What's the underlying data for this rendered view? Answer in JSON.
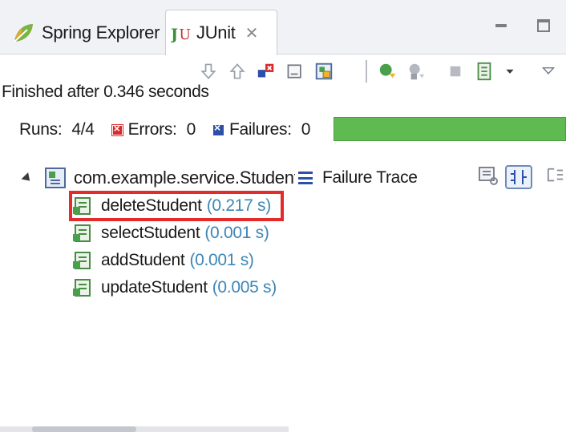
{
  "tabs": [
    {
      "label": "Spring Explorer",
      "icon": "leaf-icon",
      "active": false
    },
    {
      "label": "JUnit",
      "icon": "junit-icon",
      "active": true,
      "close": "✕"
    }
  ],
  "status": "Finished after 0.346 seconds",
  "counters": {
    "runs_label": "Runs:",
    "runs_value": "4/4",
    "errors_label": "Errors:",
    "errors_value": "0",
    "failures_label": "Failures:",
    "failures_value": "0"
  },
  "progress": {
    "fraction": 1.0,
    "color": "#5fba51"
  },
  "tree": {
    "root": "com.example.service.StudentServiceTest",
    "items": [
      {
        "name": "deleteStudent",
        "time": "(0.217 s)",
        "highlighted": true
      },
      {
        "name": "selectStudent",
        "time": "(0.001 s)",
        "highlighted": false
      },
      {
        "name": "addStudent",
        "time": "(0.001 s)",
        "highlighted": false
      },
      {
        "name": "updateStudent",
        "time": "(0.005 s)",
        "highlighted": false
      }
    ]
  },
  "failure_trace": {
    "label": "Failure Trace"
  },
  "colors": {
    "highlight": "#e32b2b",
    "time_text": "#3c86b7",
    "error": "#d62b2b",
    "failure": "#2c4fa8"
  }
}
